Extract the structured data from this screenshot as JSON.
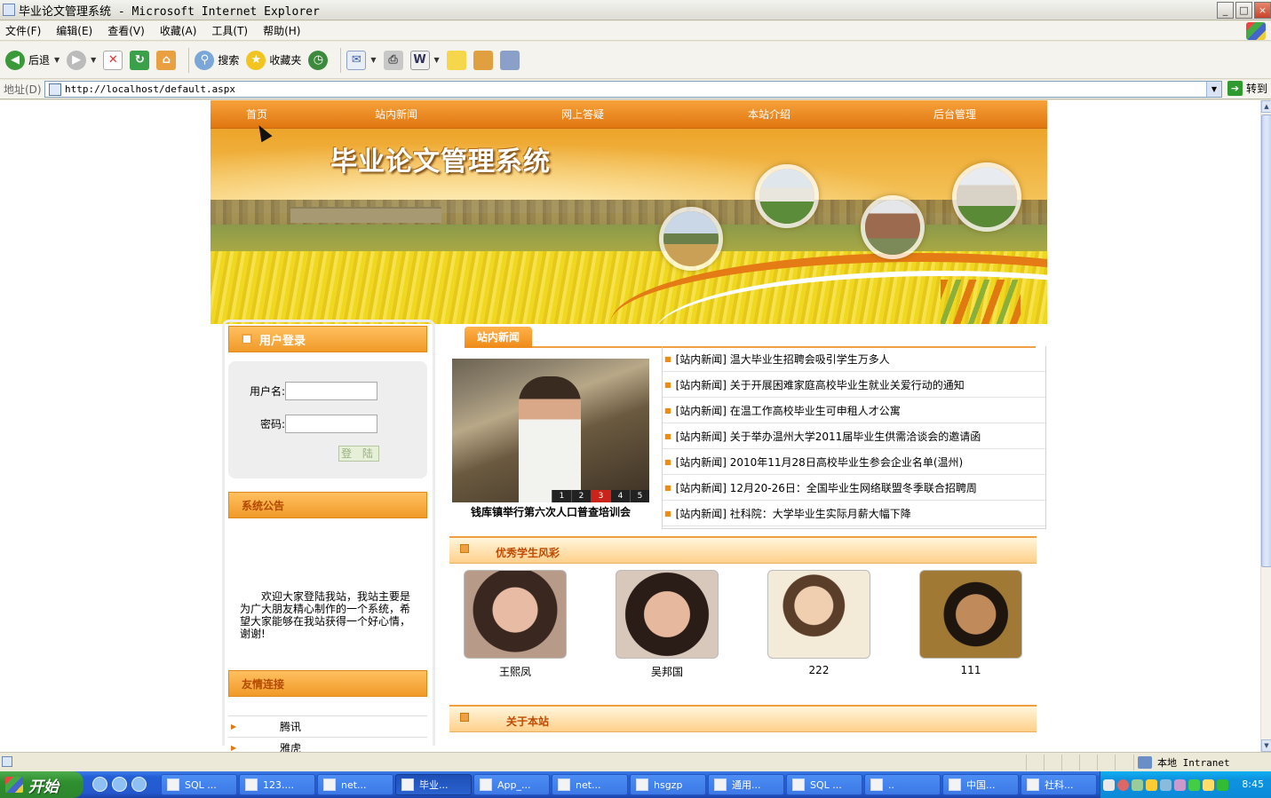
{
  "window": {
    "title": "毕业论文管理系统 - Microsoft Internet Explorer",
    "buttons": [
      "_",
      "□",
      "×"
    ]
  },
  "menu": [
    "文件(F)",
    "编辑(E)",
    "查看(V)",
    "收藏(A)",
    "工具(T)",
    "帮助(H)"
  ],
  "toolbar": {
    "back_label": "后退",
    "search_label": "搜索",
    "favorites_label": "收藏夹"
  },
  "address": {
    "label": "地址(D)",
    "url": "http://localhost/default.aspx",
    "go_label": "转到"
  },
  "site": {
    "nav": [
      "首页",
      "站内新闻",
      "网上答疑",
      "本站介绍",
      "后台管理"
    ],
    "banner_title": "毕业论文管理系统",
    "login": {
      "title": "用户登录",
      "username_label": "用户名:",
      "password_label": "密码:",
      "username_value": "",
      "password_value": "",
      "button_label": "登 陆"
    },
    "notice": {
      "title": "系统公告",
      "text": "欢迎大家登陆我站，我站主要是为广大朋友精心制作的一个系统，希望大家能够在我站获得一个好心情，谢谢!"
    },
    "friend_links": {
      "title": "友情连接",
      "items": [
        "腾讯",
        "雅虎"
      ]
    },
    "news": {
      "tab_label": "站内新闻",
      "photo_caption": "钱库镇举行第六次人口普查培训会",
      "photo_pages": [
        "1",
        "2",
        "3",
        "4",
        "5"
      ],
      "photo_active_page": 3,
      "items": [
        "[站内新闻] 温大毕业生招聘会吸引学生万多人",
        "[站内新闻] 关于开展困难家庭高校毕业生就业关爱行动的通知",
        "[站内新闻] 在温工作高校毕业生可申租人才公寓",
        "[站内新闻] 关于举办温州大学2011届毕业生供需洽谈会的邀请函",
        "[站内新闻] 2010年11月28日高校毕业生参会企业名单(温州)",
        "[站内新闻] 12月20-26日：全国毕业生网络联盟冬季联合招聘周",
        "[站内新闻] 社科院：大学毕业生实际月薪大幅下降"
      ]
    },
    "students": {
      "title": "优秀学生风彩",
      "items": [
        {
          "name": "王熙凤",
          "photo": "portrait-woman-1",
          "color": "#d9a48c"
        },
        {
          "name": "吴邦国",
          "photo": "portrait-woman-2",
          "color": "#caa088"
        },
        {
          "name": "222",
          "photo": "portrait-young-man-1",
          "color": "#e7d2b0"
        },
        {
          "name": "111",
          "photo": "portrait-young-man-2",
          "color": "#a8843e"
        }
      ]
    },
    "about_title": "关于本站"
  },
  "status": {
    "zone": "本地 Intranet"
  },
  "taskbar": {
    "start_label": "开始",
    "tasks": [
      {
        "label": "SQL ...",
        "active": false
      },
      {
        "label": "123....",
        "active": false
      },
      {
        "label": "net...",
        "active": false
      },
      {
        "label": "毕业...",
        "active": true
      },
      {
        "label": "App_...",
        "active": false
      },
      {
        "label": "net...",
        "active": false
      },
      {
        "label": "hsgzp",
        "active": false
      },
      {
        "label": "通用...",
        "active": false
      },
      {
        "label": "SQL ...",
        "active": false
      },
      {
        "label": "..",
        "active": false
      },
      {
        "label": "中国...",
        "active": false
      },
      {
        "label": "社科...",
        "active": false
      }
    ],
    "clock": "8:45"
  },
  "colors": {
    "accent_orange": "#f08a10",
    "header_title": "#c04a00",
    "xp_blue": "#245fd6"
  }
}
